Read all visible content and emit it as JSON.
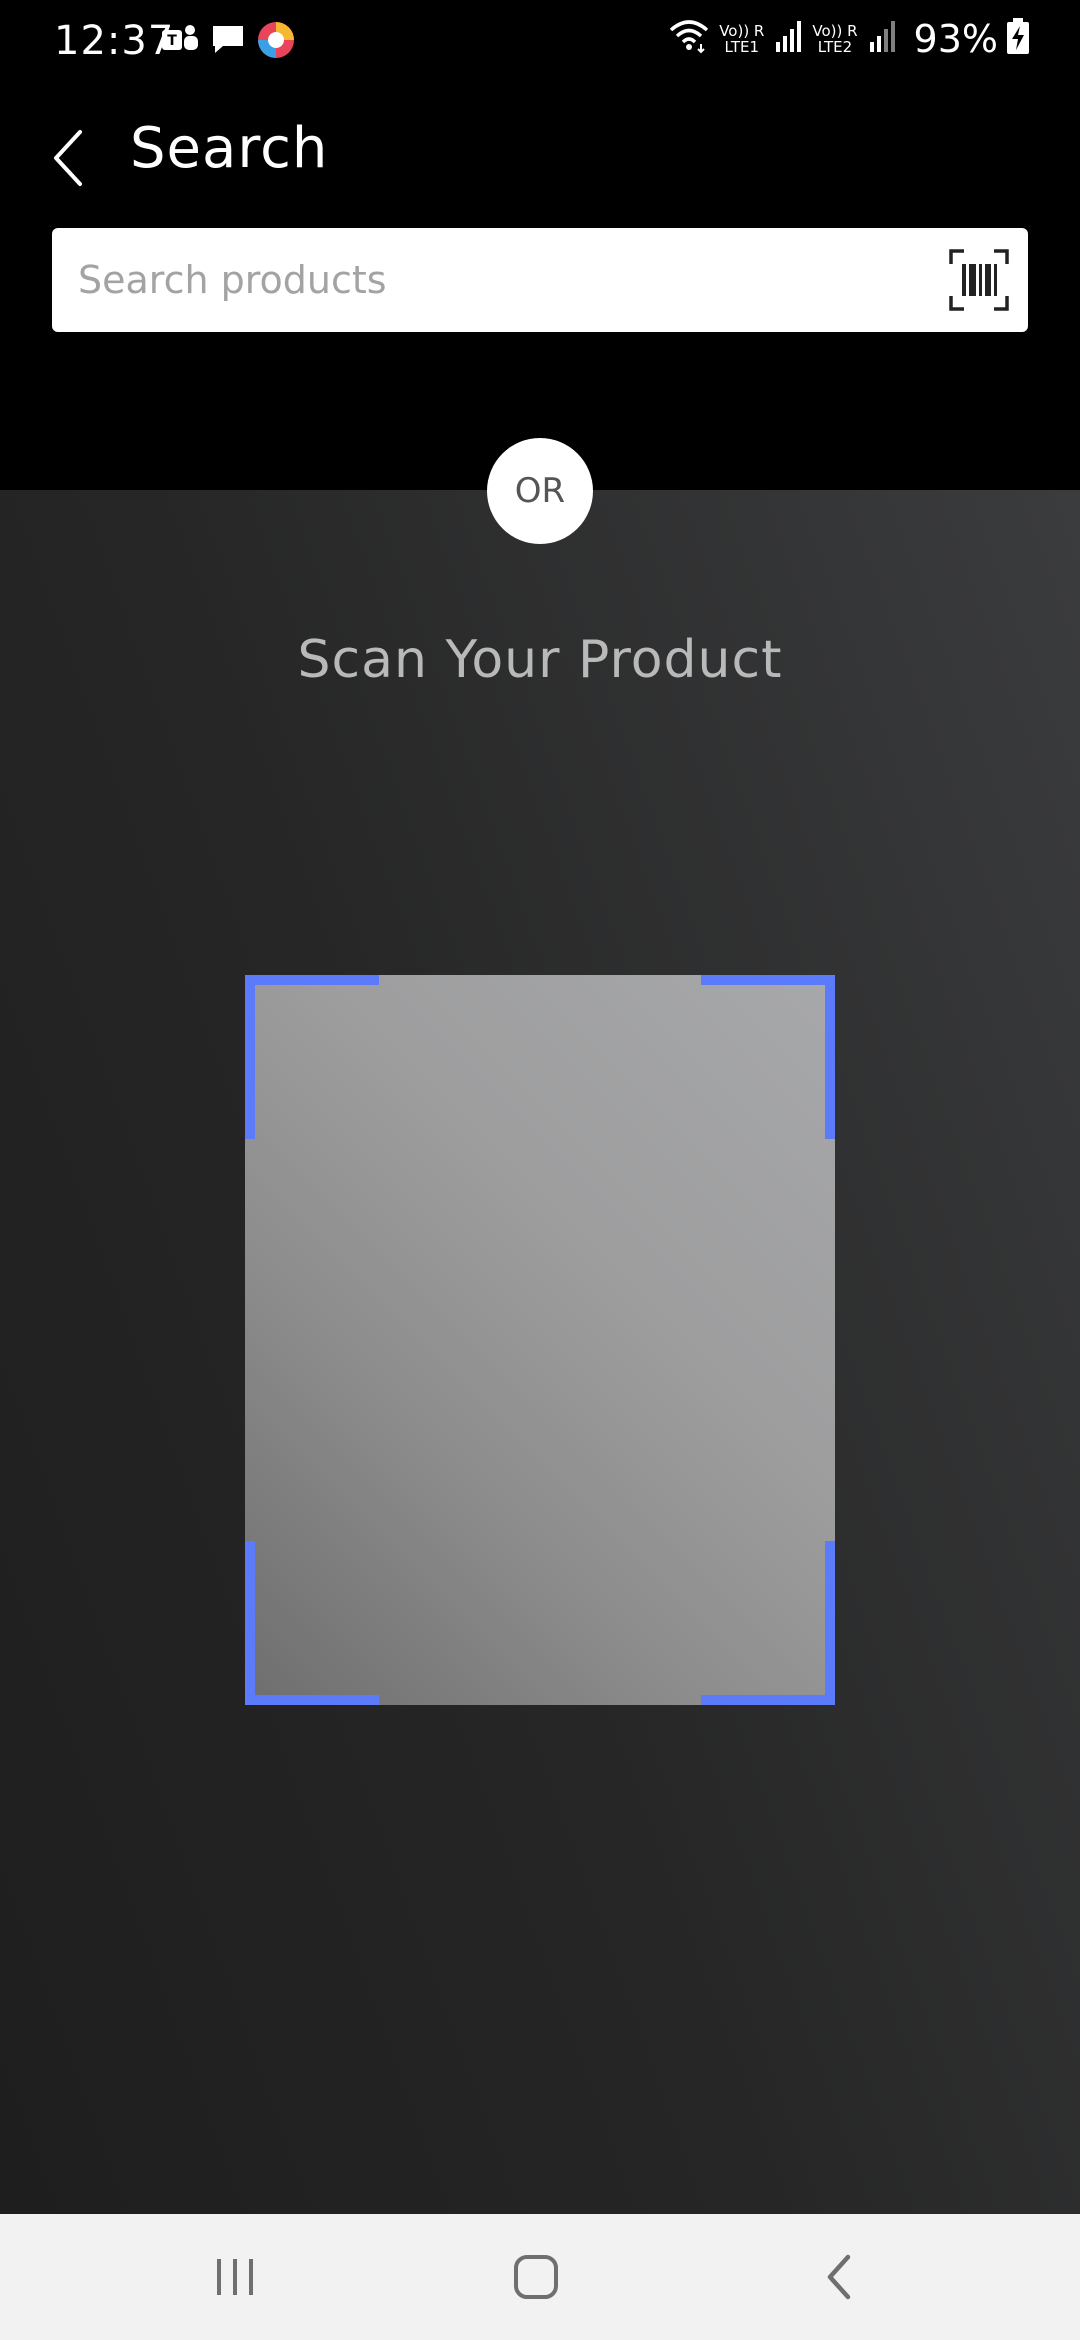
{
  "status_bar": {
    "time": "12:37",
    "notification_icons": [
      "teams-icon",
      "message-icon",
      "app-icon"
    ],
    "sim1_label_top": "Vo)) R",
    "sim1_label_bottom": "LTE1",
    "sim2_label_top": "Vo)) R",
    "sim2_label_bottom": "LTE2",
    "battery_percent": "93%"
  },
  "header": {
    "back_icon": "chevron-left-icon",
    "title": "Search"
  },
  "search": {
    "placeholder": "Search products",
    "value": "",
    "scan_icon": "barcode-scan-icon"
  },
  "scanner": {
    "or_label": "OR",
    "title": "Scan Your Product",
    "frame_corner_color": "#5c7bfa"
  },
  "nav_bar": {
    "recents_icon": "recents-icon",
    "home_icon": "home-icon",
    "back_icon": "back-icon"
  },
  "colors": {
    "header_bg": "#000000",
    "accent": "#5c7bfa",
    "nav_bg": "#f2f2f2"
  }
}
